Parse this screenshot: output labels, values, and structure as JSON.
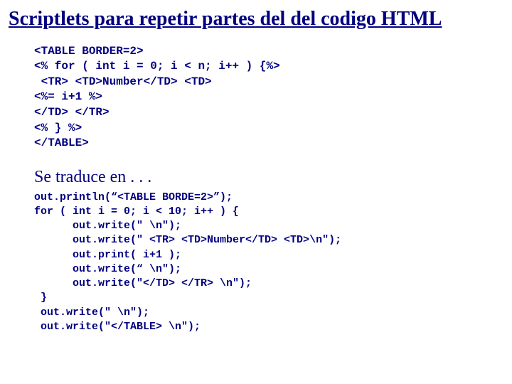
{
  "title": "Scriptlets para repetir partes del del codigo HTML",
  "code1": "<TABLE BORDER=2>\n<% for ( int i = 0; i < n; i++ ) {%>\n <TR> <TD>Number</TD> <TD>\n<%= i+1 %>\n</TD> </TR>\n<% } %>\n</TABLE>",
  "subheading": "Se traduce en . . .",
  "code2": "out.println(“<TABLE BORDE=2>”);\nfor ( int i = 0; i < 10; i++ ) {\n      out.write(\" \\n\");\n      out.write(\" <TR> <TD>Number</TD> <TD>\\n\");\n      out.print( i+1 );\n      out.write(“ \\n\");\n      out.write(\"</TD> </TR> \\n\");\n }\n out.write(\" \\n\");\n out.write(\"</TABLE> \\n\");"
}
